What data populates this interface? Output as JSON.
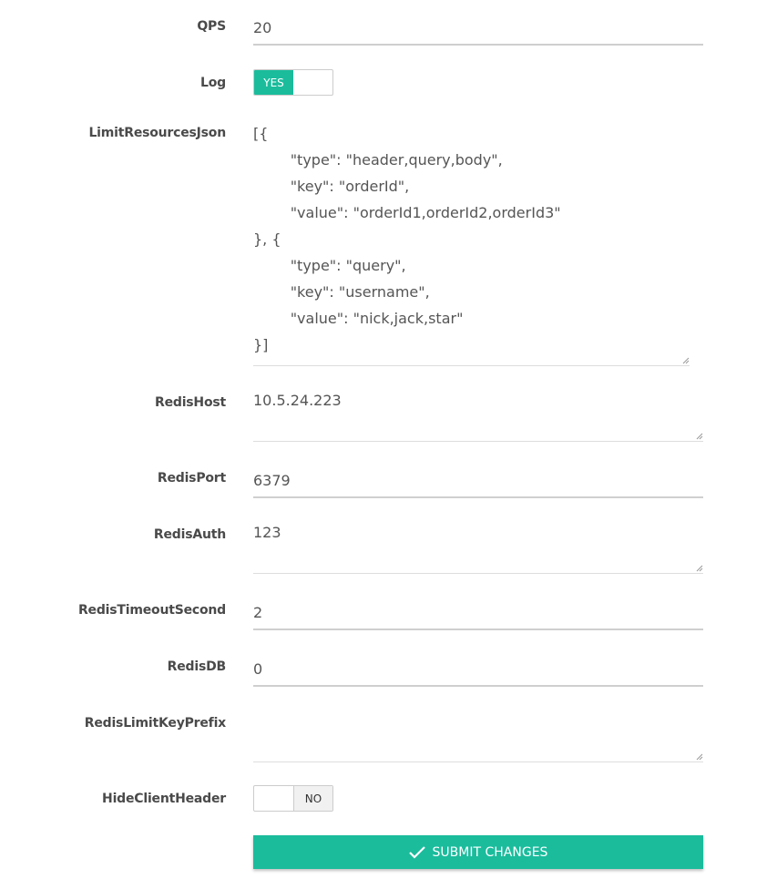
{
  "accent_color": "#1abc9c",
  "form": {
    "qps": {
      "label": "QPS",
      "value": "20"
    },
    "log": {
      "label": "Log",
      "on_text": "YES",
      "state": "on"
    },
    "limit_resources_json": {
      "label": "LimitResourcesJson",
      "lines": [
        "[{",
        "        \"type\": \"header,query,body\",",
        "        \"key\": \"orderId\",",
        "        \"value\": \"orderId1,orderId2,orderId3\"",
        "}, {",
        "        \"type\": \"query\",",
        "        \"key\": \"username\",",
        "        \"value\": \"nick,jack,star\"",
        "}]"
      ]
    },
    "redis_host": {
      "label": "RedisHost",
      "value": "10.5.24.223"
    },
    "redis_port": {
      "label": "RedisPort",
      "value": "6379"
    },
    "redis_auth": {
      "label": "RedisAuth",
      "value": "123"
    },
    "redis_timeout_second": {
      "label": "RedisTimeoutSecond",
      "value": "2"
    },
    "redis_db": {
      "label": "RedisDB",
      "value": "0"
    },
    "redis_limit_key_prefix": {
      "label": "RedisLimitKeyPrefix",
      "value": ""
    },
    "hide_client_header": {
      "label": "HideClientHeader",
      "off_text": "NO",
      "state": "off"
    }
  },
  "submit": {
    "label": "SUBMIT CHANGES",
    "icon": "check-icon"
  }
}
